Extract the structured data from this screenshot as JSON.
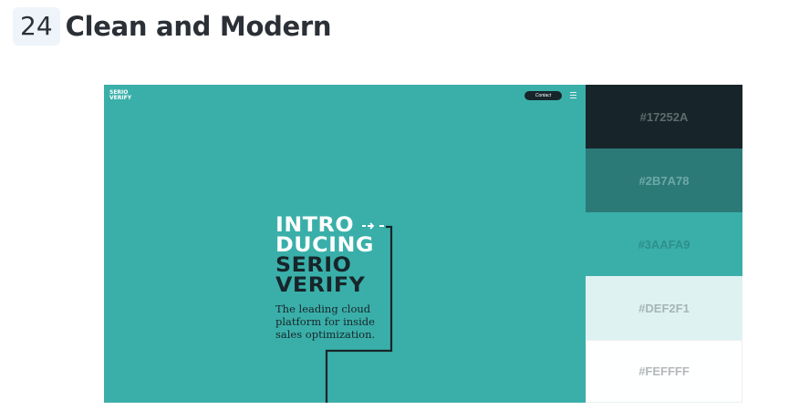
{
  "heading": {
    "number": "24",
    "title": "Clean and Modern"
  },
  "site": {
    "logo": [
      "SERIO",
      "VERIFY"
    ],
    "contact_label": "Contact",
    "hero_lines": [
      "INTRO",
      "DUCING",
      "SERIO",
      "VERIFY"
    ],
    "tagline": "The leading cloud platform for inside sales optimization."
  },
  "palette": [
    {
      "hex": "#17252A",
      "bg": "#17252a",
      "text": "#5e6a6e"
    },
    {
      "hex": "#2B7A78",
      "bg": "#2b7a78",
      "text": "#6fa9a6"
    },
    {
      "hex": "#3AAFA9",
      "bg": "#3aafa9",
      "text": "#2f8f8a"
    },
    {
      "hex": "#DEF2F1",
      "bg": "#def2f1",
      "text": "#a7b6b5"
    },
    {
      "hex": "#FEFFFF",
      "bg": "#feffff",
      "text": "#b4b8ba"
    }
  ]
}
